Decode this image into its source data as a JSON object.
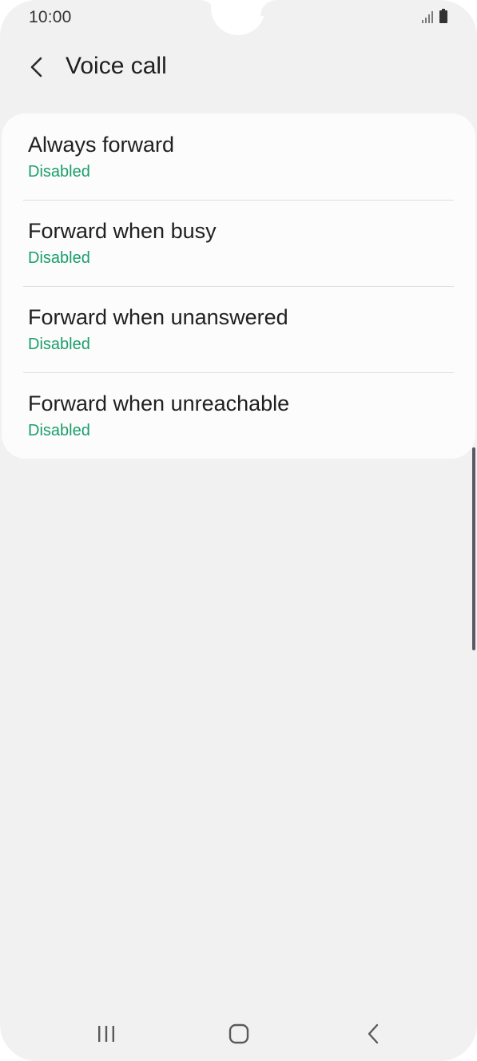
{
  "status_bar": {
    "time": "10:00",
    "icons": [
      "signal-icon",
      "battery-icon"
    ]
  },
  "header": {
    "back_icon": "chevron-left-icon",
    "title": "Voice call"
  },
  "settings": {
    "items": [
      {
        "label": "Always forward",
        "status": "Disabled"
      },
      {
        "label": "Forward when busy",
        "status": "Disabled"
      },
      {
        "label": "Forward when unanswered",
        "status": "Disabled"
      },
      {
        "label": "Forward when unreachable",
        "status": "Disabled"
      }
    ]
  },
  "nav_bar": {
    "icons": [
      "recent-apps-icon",
      "home-icon",
      "back-icon"
    ]
  },
  "colors": {
    "background": "#f1f1f1",
    "card": "#fcfcfc",
    "status_text": "#199e6b",
    "primary_text": "#202020"
  }
}
